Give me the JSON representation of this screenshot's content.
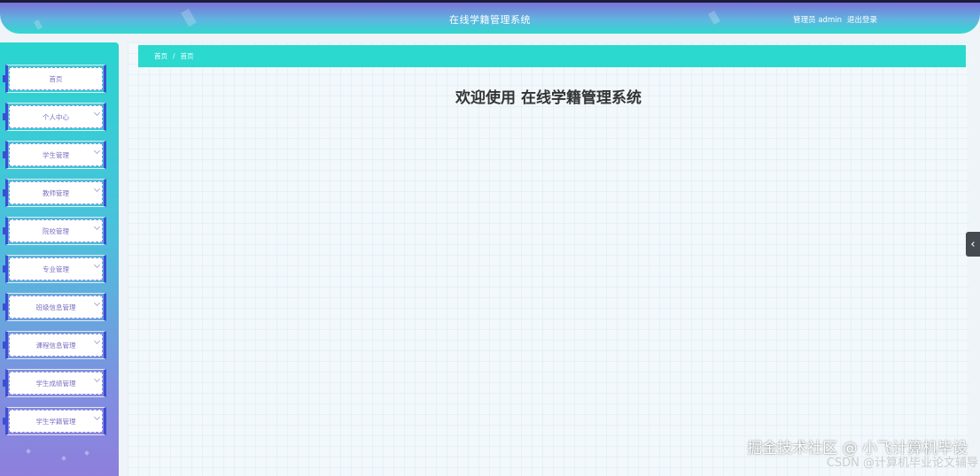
{
  "header": {
    "app_title": "在线学籍管理系统",
    "user_role": "管理员",
    "username": "admin",
    "logout_label": "退出登录"
  },
  "sidebar": {
    "items": [
      {
        "label": "首页",
        "has_submenu": false
      },
      {
        "label": "个人中心",
        "has_submenu": true
      },
      {
        "label": "学生管理",
        "has_submenu": true
      },
      {
        "label": "教师管理",
        "has_submenu": true
      },
      {
        "label": "院校管理",
        "has_submenu": true
      },
      {
        "label": "专业管理",
        "has_submenu": true
      },
      {
        "label": "班级信息管理",
        "has_submenu": true
      },
      {
        "label": "课程信息管理",
        "has_submenu": true
      },
      {
        "label": "学生成绩管理",
        "has_submenu": true
      },
      {
        "label": "学生学籍管理",
        "has_submenu": true
      }
    ]
  },
  "breadcrumb": {
    "root": "首页",
    "separator": "/",
    "current": "首页"
  },
  "main": {
    "welcome": "欢迎使用 在线学籍管理系统"
  },
  "watermark": {
    "line1": "掘金技术社区 @ 小飞计算机毕设",
    "line2": "CSDN @计算机毕业论文辅导"
  },
  "colors": {
    "accent": "#2bd9cf",
    "sidebar_frame": "#3b4fd6",
    "header_top": "#7b74d6"
  }
}
